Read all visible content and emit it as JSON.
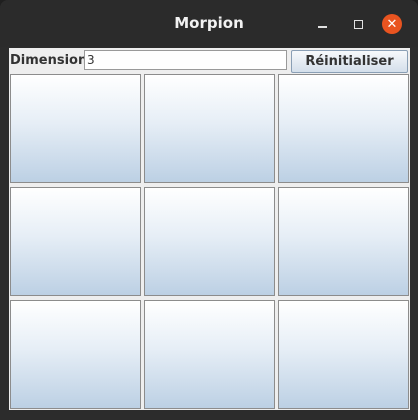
{
  "window": {
    "title": "Morpion",
    "controls": [
      "minimize-icon",
      "maximize-icon",
      "close-icon"
    ],
    "close_color": "#e95420"
  },
  "toolbar": {
    "dimension_label": "Dimension",
    "dimension_value": "3",
    "reset_label": "Réinitialiser"
  },
  "board": {
    "size": 3,
    "cells": [
      "",
      "",
      "",
      "",
      "",
      "",
      "",
      "",
      ""
    ]
  }
}
